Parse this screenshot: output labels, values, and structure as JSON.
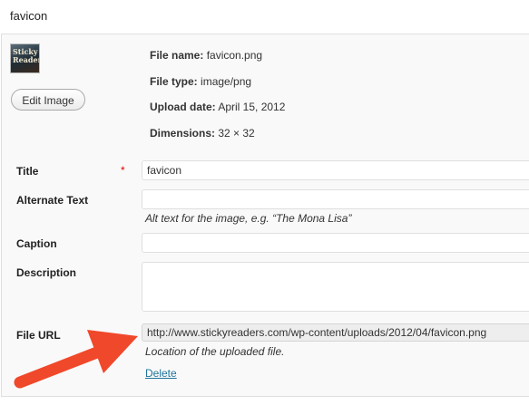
{
  "header": {
    "title": "favicon"
  },
  "thumbnail": {
    "line1": "Sticky",
    "line2": "Readers"
  },
  "edit_button": {
    "label": "Edit Image"
  },
  "meta": {
    "file_name": {
      "label": "File name:",
      "value": "favicon.png"
    },
    "file_type": {
      "label": "File type:",
      "value": "image/png"
    },
    "upload_date": {
      "label": "Upload date:",
      "value": "April 15, 2012"
    },
    "dimensions": {
      "label": "Dimensions:",
      "value": "32 × 32"
    }
  },
  "form": {
    "title": {
      "label": "Title",
      "required_mark": "*",
      "value": "favicon"
    },
    "alt_text": {
      "label": "Alternate Text",
      "value": "",
      "help": "Alt text for the image, e.g. “The Mona Lisa”"
    },
    "caption": {
      "label": "Caption",
      "value": ""
    },
    "description": {
      "label": "Description",
      "value": ""
    },
    "file_url": {
      "label": "File URL",
      "value": "http://www.stickyreaders.com/wp-content/uploads/2012/04/favicon.png",
      "help": "Location of the uploaded file."
    }
  },
  "delete_link": {
    "label": "Delete"
  },
  "colors": {
    "arrow": "#f0482a",
    "link": "#21759b",
    "required": "#dd0000"
  }
}
